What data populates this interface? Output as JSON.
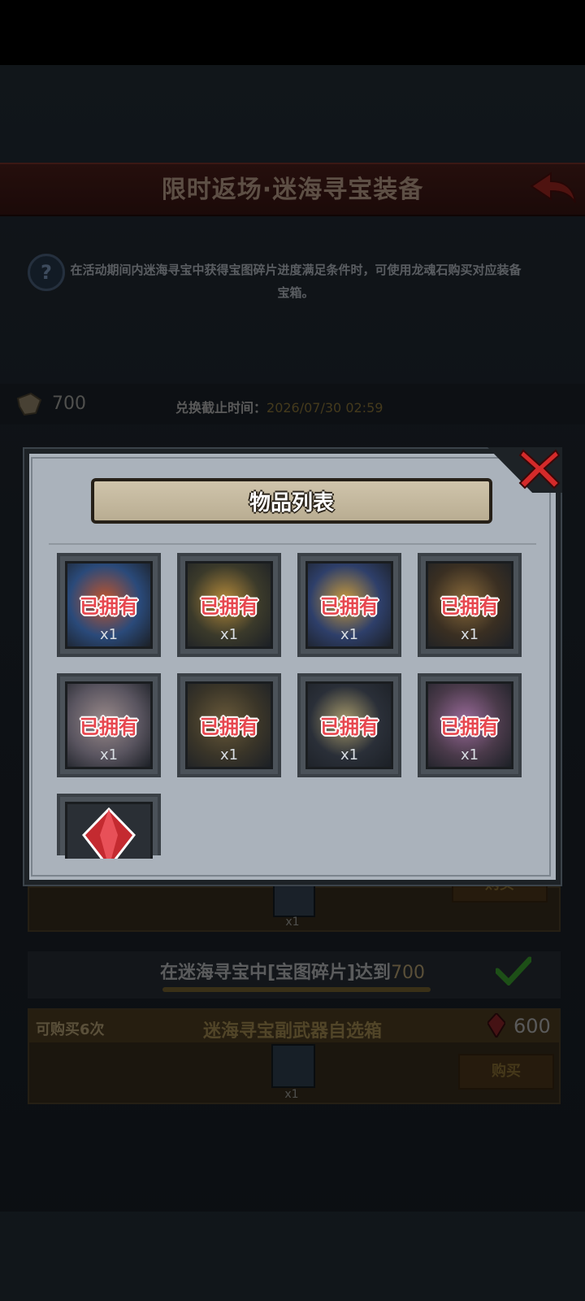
{
  "page": {
    "title": "限时返场·迷海寻宝装备",
    "help_text": "在活动期间内迷海寻宝中获得宝图碎片进度满足条件时，可使用龙魂石购买对应装备宝箱。",
    "currency_value": "700",
    "deadline_label": "兑换截止时间：",
    "deadline_value": "2026/07/30 02:59"
  },
  "underlay": {
    "card1_buy_label": "购买",
    "card1_qty": "x1",
    "progress_label": "在迷海寻宝中[宝图碎片]达到",
    "progress_target": "700",
    "card2_limit": "可购买6次",
    "card2_title": "迷海寻宝副武器自选箱",
    "card2_price": "600",
    "card2_qty": "x1",
    "card2_buy_label": "购买"
  },
  "modal": {
    "title": "物品列表",
    "items": [
      {
        "status": "已拥有",
        "qty": "x1",
        "color_a": "#2a4a7a",
        "color_b": "#c2542a"
      },
      {
        "status": "已拥有",
        "qty": "x1",
        "color_a": "#3b3a2a",
        "color_b": "#b58a3a"
      },
      {
        "status": "已拥有",
        "qty": "x1",
        "color_a": "#2e3f6a",
        "color_b": "#c99a3a"
      },
      {
        "status": "已拥有",
        "qty": "x1",
        "color_a": "#3a2f22",
        "color_b": "#8a6a3a"
      },
      {
        "status": "已拥有",
        "qty": "x1",
        "color_a": "#5a5560",
        "color_b": "#9a8a8a"
      },
      {
        "status": "已拥有",
        "qty": "x1",
        "color_a": "#3a3528",
        "color_b": "#6a5a3a"
      },
      {
        "status": "已拥有",
        "qty": "x1",
        "color_a": "#2a2f38",
        "color_b": "#a89a6a"
      },
      {
        "status": "已拥有",
        "qty": "x1",
        "color_a": "#4a3a4a",
        "color_b": "#9a6a9a"
      }
    ],
    "last_item_icon": "red-gem-icon"
  },
  "colors": {
    "owned_text": "#e7474f",
    "modal_bg": "#aab2bb",
    "accent_gold": "#6a5a2c"
  }
}
